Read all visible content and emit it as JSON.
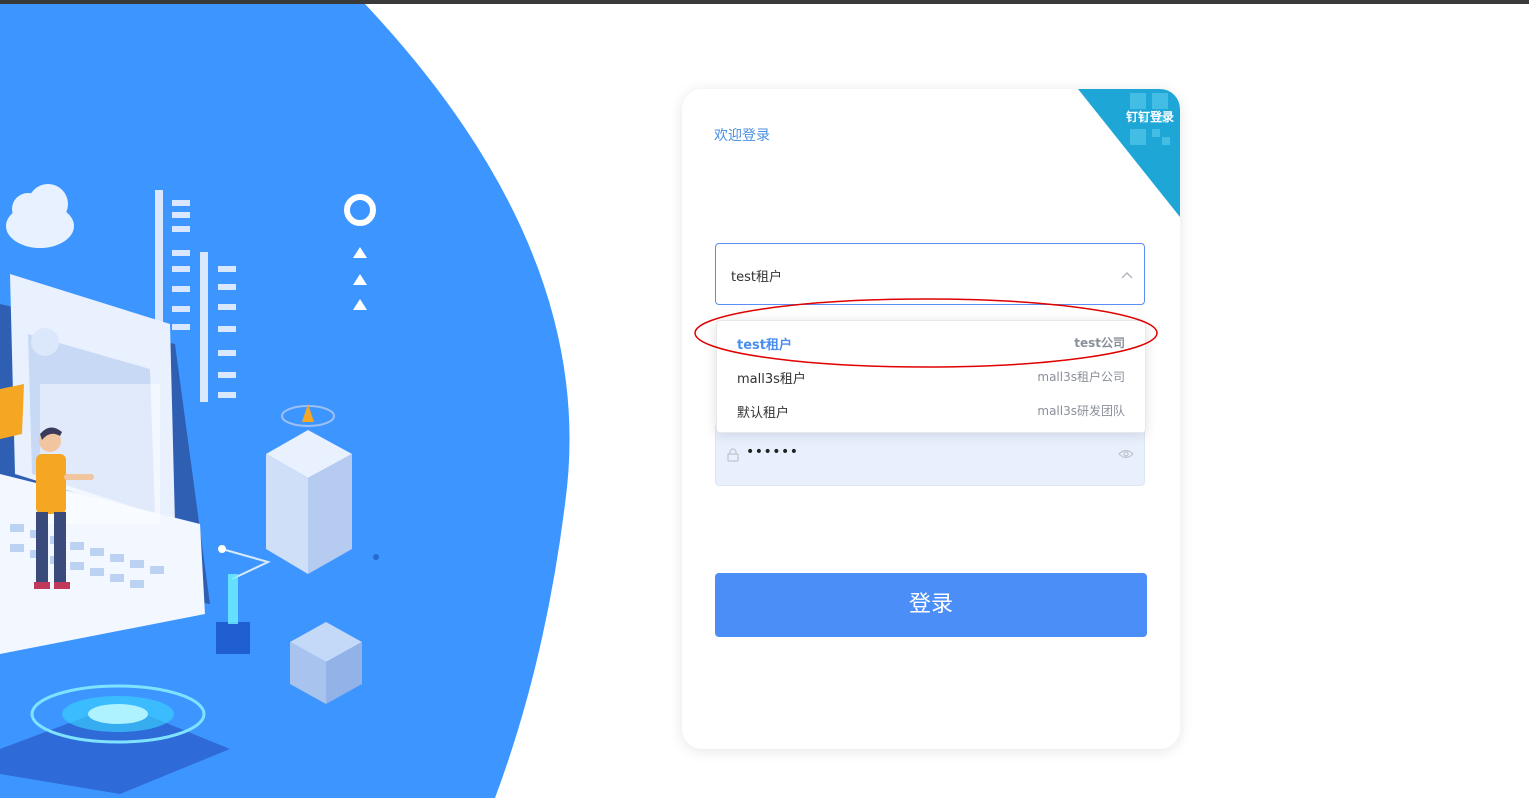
{
  "login": {
    "welcome": "欢迎登录",
    "dingtalk_label": "钉钉登录",
    "tenant_select": {
      "value": "test租户"
    },
    "tenant_options": [
      {
        "name": "test租户",
        "company": "test公司",
        "selected": true
      },
      {
        "name": "mall3s租户",
        "company": "mall3s租户公司",
        "selected": false
      },
      {
        "name": "默认租户",
        "company": "mall3s研发团队",
        "selected": false
      }
    ],
    "password": {
      "value": "••••••"
    },
    "submit_label": "登录"
  },
  "colors": {
    "brand_blue": "#3d96ff",
    "button_blue": "#4c8ef7",
    "corner_teal": "#1ea7d6",
    "annotation_red": "#e00000"
  }
}
